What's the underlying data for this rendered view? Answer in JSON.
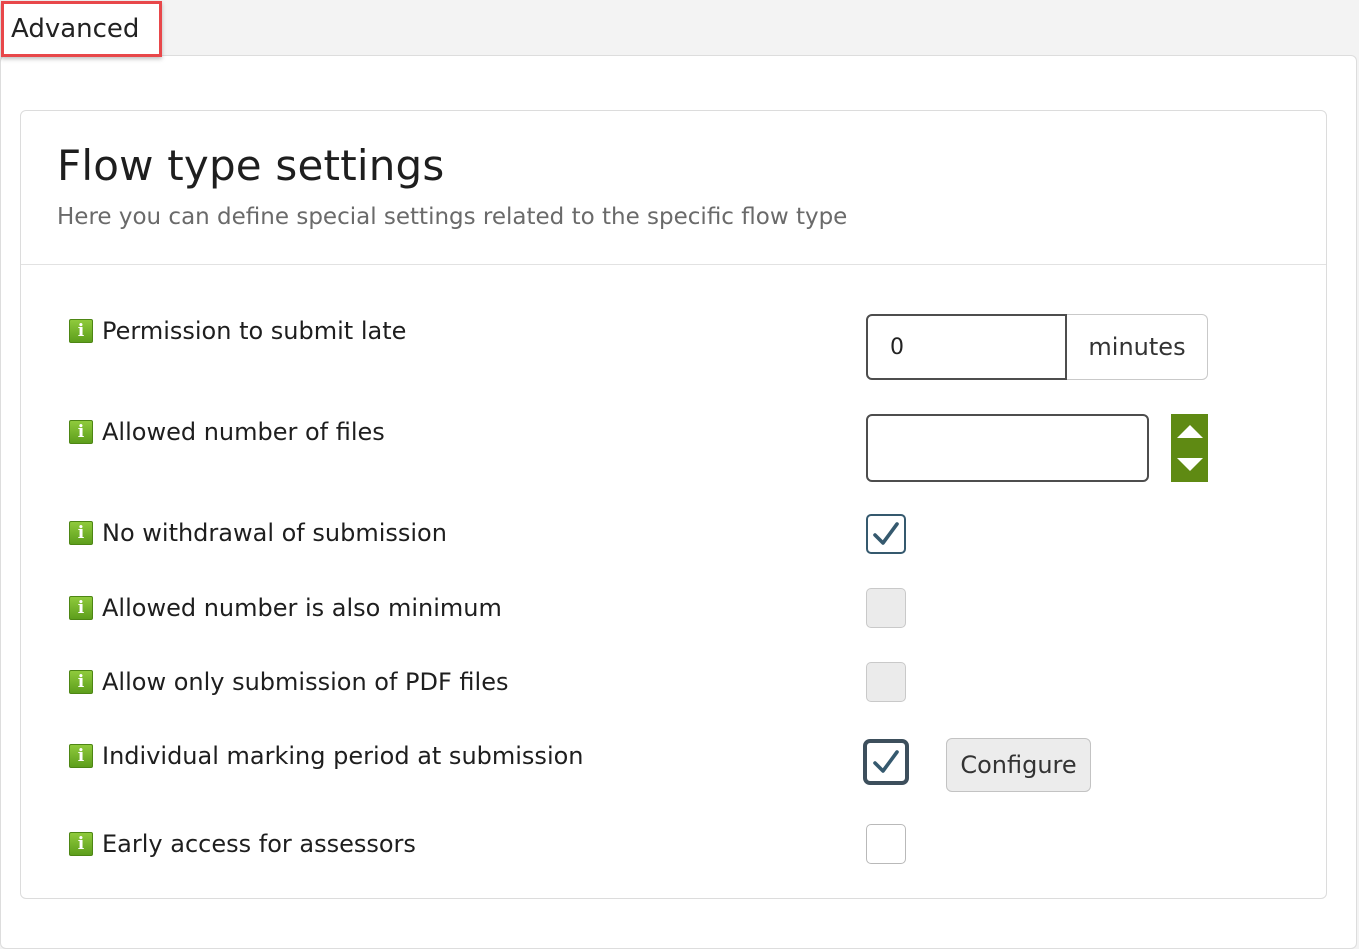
{
  "tab": {
    "label": "Advanced"
  },
  "header": {
    "title": "Flow type settings",
    "subtitle": "Here you can define special settings related to the specific flow type"
  },
  "settings": [
    {
      "label": "Permission to submit late",
      "control": "number-with-unit",
      "value": "0",
      "unit": "minutes"
    },
    {
      "label": "Allowed number of files",
      "control": "spinner",
      "value": ""
    },
    {
      "label": "No withdrawal of submission",
      "control": "checkbox",
      "state": "checked"
    },
    {
      "label": "Allowed number is also minimum",
      "control": "checkbox",
      "state": "disabled"
    },
    {
      "label": "Allow only submission of PDF files",
      "control": "checkbox",
      "state": "disabled"
    },
    {
      "label": "Individual marking period at submission",
      "control": "checkbox",
      "state": "checked-focused"
    },
    {
      "label": "Early access for assessors",
      "control": "checkbox",
      "state": "unchecked"
    }
  ],
  "buttons": {
    "configure": "Configure"
  },
  "icons": {
    "info": "info-icon",
    "check": "checkmark-icon",
    "up": "arrow-up-icon",
    "down": "arrow-down-icon"
  },
  "colors": {
    "accent_green": "#5f8a13",
    "info_green": "#7cb82f",
    "check_blue": "#35596e",
    "tab_highlight": "#e8474a"
  }
}
